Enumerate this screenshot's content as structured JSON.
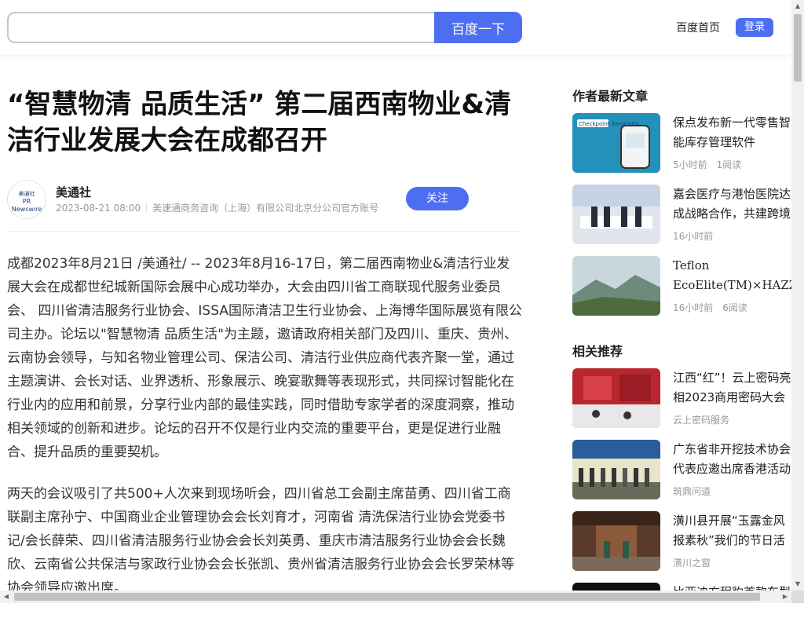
{
  "header": {
    "search_placeholder": "",
    "search_button": "百度一下",
    "home_link": "百度首页",
    "login_button": "登录"
  },
  "article": {
    "title": "“智慧物清 品质生活” 第二届西南物业&清洁行业发展大会在成都召开",
    "author": {
      "avatar_line1": "美通社",
      "avatar_line2": "PR Newswire",
      "name": "美通社",
      "date": "2023-08-21 08:00",
      "account": "美速通商务咨询（上海）有限公司北京分公司官方账号",
      "follow_button": "关注"
    },
    "paragraphs": [
      "成都2023年8月21日 /美通社/ -- 2023年8月16-17日，第二届西南物业&清洁行业发展大会在成都世纪城新国际会展中心成功举办，大会由四川省工商联现代服务业委员会、 四川省清洁服务行业协会、ISSA国际清洁卫生行业协会、上海博华国际展览有限公司主办。论坛以\"智慧物清 品质生活\"为主题，邀请政府相关部门及四川、重庆、贵州、云南协会领导，与知名物业管理公司、保洁公司、清洁行业供应商代表齐聚一堂，通过主题演讲、会长对话、业界透析、形象展示、晚宴歌舞等表现形式，共同探讨智能化在行业内的应用和前景，分享行业内部的最佳实践，同时借助专家学者的深度洞察，推动相关领域的创新和进步。论坛的召开不仅是行业内交流的重要平台，更是促进行业融合、提升品质的重要契机。",
      "两天的会议吸引了共500+人次来到现场听会，四川省总工会副主席苗勇、四川省工商联副主席孙宁、中国商业企业管理协会会长刘育才，河南省 清洗保洁行业协会党委书记/会长薛荣、四川省清洁服务行业协会会长刘英勇、重庆市清洁服务行业协会会长魏欣、云南省公共保洁与家政行业协会会长张凯、贵州省清洁服务行业协会会长罗荣林等协会领导应邀出席。"
    ]
  },
  "sidebar": {
    "latest_heading": "作者最新文章",
    "latest": [
      {
        "title": "保点发布新一代零售智能库存管理软件ItemOptix",
        "time": "5小时前",
        "reads": "1阅读",
        "thumb_text": "Checkpoint ItemOptix",
        "color": "#1d7fa8"
      },
      {
        "title": "嘉会医疗与港怡医院达成战略合作，共建跨境医疗服务平台",
        "time": "16小时前",
        "reads": "",
        "thumb_text": "",
        "color": "#7a8ca0"
      },
      {
        "title": "Teflon EcoElite(TM)×HAZZYS",
        "time": "16小时前",
        "reads": "6阅读",
        "thumb_text": "",
        "color": "#6f8f6a"
      }
    ],
    "related_heading": "相关推荐",
    "related": [
      {
        "title": "江西“红”！云上密码亮相2023商用密码大会",
        "source": "云上密码服务",
        "color": "#b8262e"
      },
      {
        "title": "广东省非开挖技术协会代表应邀出席香港活动",
        "source": "筑鼎问道",
        "color": "#6a6a5a"
      },
      {
        "title": "潢川县开展“玉露金风报素秋”我们的节日活动",
        "source": "潢川之窗",
        "color": "#5a3a2a"
      },
      {
        "title": "比亚迪方程豹首款车型",
        "source": "",
        "color": "#111111"
      }
    ]
  }
}
